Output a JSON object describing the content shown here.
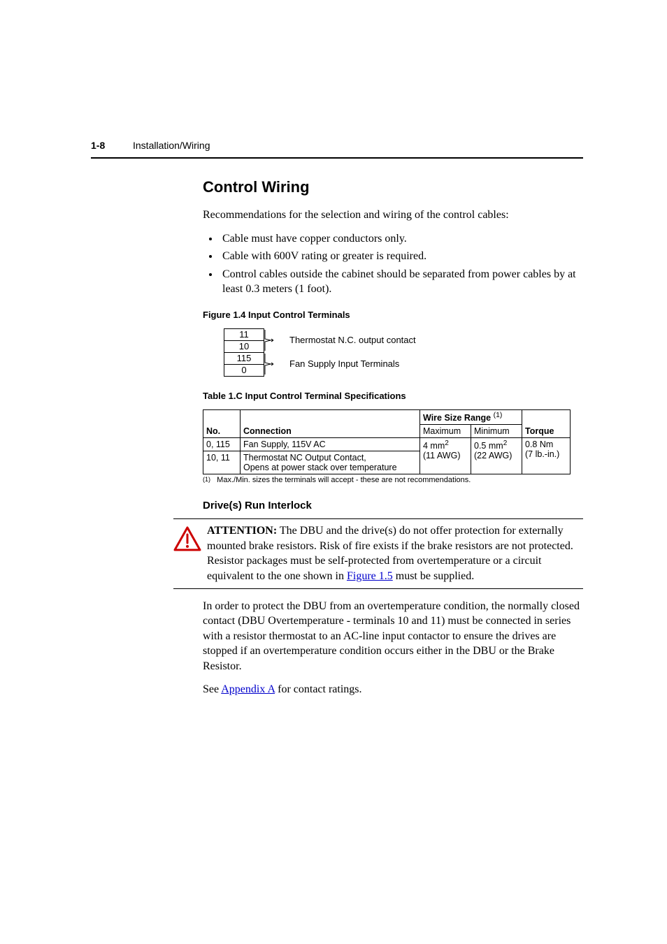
{
  "header": {
    "page_num": "1-8",
    "section_label": "Installation/Wiring"
  },
  "section_title": "Control Wiring",
  "intro": "Recommendations for the selection and wiring of the control cables:",
  "bullets": [
    "Cable must have copper conductors only.",
    "Cable with 600V rating or greater is required.",
    "Control cables outside the cabinet should be separated from power cables by at least 0.3 meters (1 foot)."
  ],
  "figure": {
    "caption": "Figure 1.4  Input Control Terminals",
    "terminals": [
      "11",
      "10",
      "115",
      "0"
    ],
    "label1": "Thermostat N.C. output contact",
    "label2": "Fan Supply Input Terminals"
  },
  "table": {
    "caption": "Table 1.C   Input Control Terminal Specifications",
    "head_no": "No.",
    "head_conn": "Connection",
    "head_wire": "Wire Size Range",
    "head_wire_sup": "(1)",
    "head_max": "Maximum",
    "head_min": "Minimum",
    "head_torque": "Torque",
    "rows": [
      {
        "no": "0, 115",
        "conn": "Fan Supply, 115V AC"
      },
      {
        "no": "10, 11",
        "conn": "Thermostat NC Output Contact,\nOpens at power stack over temperature"
      }
    ],
    "max_top": "4 mm",
    "max_top_sup": "2",
    "max_bot": "(11 AWG)",
    "min_top": "0.5 mm",
    "min_top_sup": "2",
    "min_bot": "(22 AWG)",
    "torq_top": "0.8 Nm",
    "torq_bot": "(7 lb.-in.)"
  },
  "footnote_sup": "(1)",
  "footnote": "Max./Min. sizes the terminals will accept - these are not recommendations.",
  "subheading": "Drive(s) Run Interlock",
  "attention": {
    "label": "ATTENTION:",
    "body1": "  The DBU and the drive(s) do not offer protection for externally mounted brake resistors. Risk of fire exists if the brake resistors are not protected. Resistor packages must be self-protected from overtemperature or a circuit equivalent to the one shown in ",
    "link1": "Figure 1.5",
    "body2": " must be supplied."
  },
  "para2a": "In order to protect the DBU from an overtemperature condition, the normally closed contact (DBU Overtemperature - terminals 10 and 11) must be connected in series with a resistor thermostat to an AC-line input contactor to ensure the drives are stopped if an overtemperature condition occurs either in the DBU or the Brake Resistor.",
  "para2b_pre": "See ",
  "para2b_link": "Appendix A",
  "para2b_post": " for contact ratings."
}
